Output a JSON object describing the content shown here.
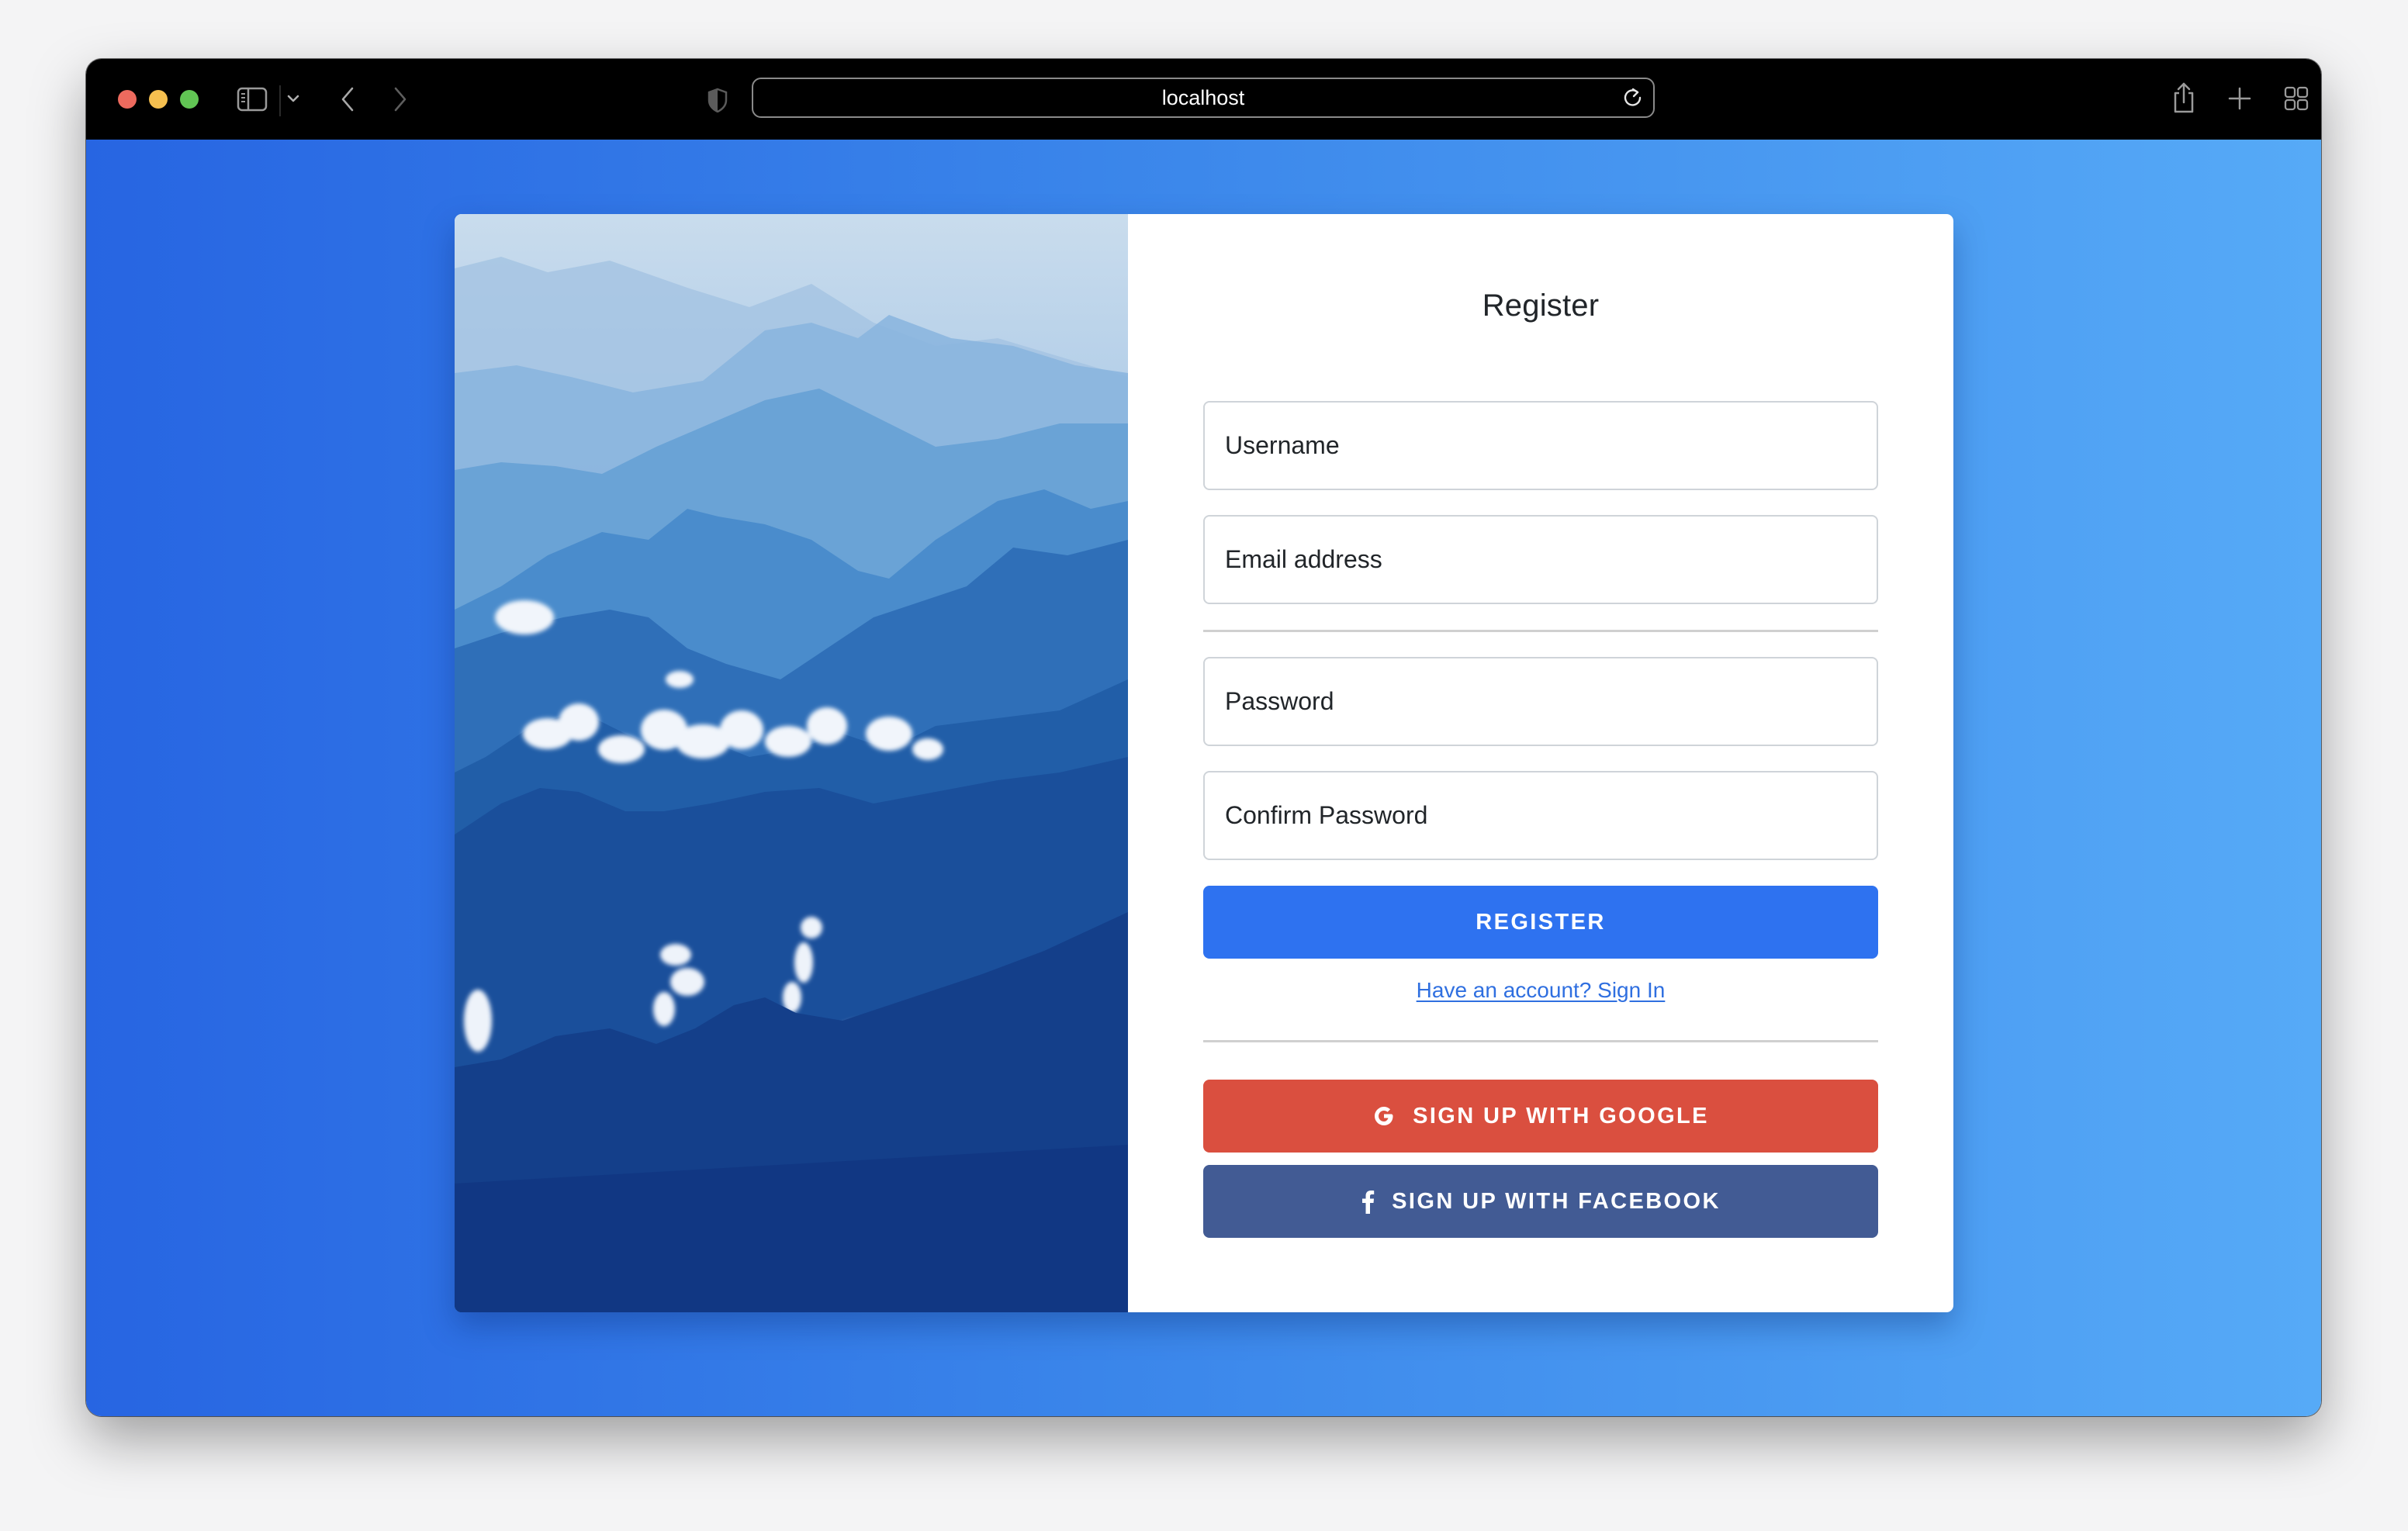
{
  "browser": {
    "address": "localhost",
    "icons": {
      "sidebar": "sidebar-icon",
      "chevron": "chevron-down-icon",
      "back": "back-icon",
      "forward": "forward-icon",
      "shield": "privacy-shield-icon",
      "reload": "reload-icon",
      "share": "share-icon",
      "new_tab": "plus-icon",
      "tabs": "tab-overview-icon"
    }
  },
  "colors": {
    "background_start": "#2765e2",
    "background_end": "#56aaf7",
    "primary": "#2e72f0",
    "google": "#da4f3f",
    "facebook": "#425b94",
    "link": "#2f6fe0"
  },
  "form": {
    "title": "Register",
    "fields": [
      {
        "name": "username",
        "placeholder": "Username",
        "value": ""
      },
      {
        "name": "email",
        "placeholder": "Email address",
        "value": ""
      },
      {
        "name": "password",
        "placeholder": "Password",
        "value": ""
      },
      {
        "name": "confirm_password",
        "placeholder": "Confirm Password",
        "value": ""
      }
    ],
    "register_label": "REGISTER",
    "signin_link": "Have an account? Sign In",
    "google_label": "SIGN UP WITH GOOGLE",
    "facebook_label": "SIGN UP WITH FACEBOOK"
  },
  "image": {
    "description": "Misty blue mountain ranges with clouds"
  }
}
